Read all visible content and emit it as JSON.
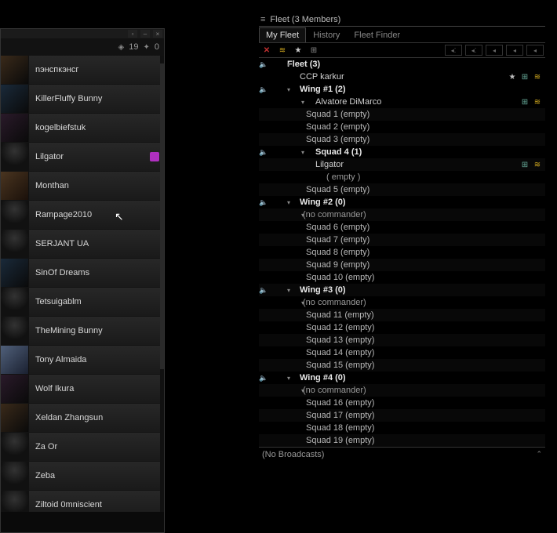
{
  "left_panel": {
    "stat1_icon": "◈",
    "stat1_val": "19",
    "stat2_icon": "✦",
    "stat2_val": "0",
    "members": [
      {
        "name": "nэнспкэнсг",
        "pclass": "p1"
      },
      {
        "name": "KillerFluffy Bunny",
        "pclass": "p2"
      },
      {
        "name": "kogelbiefstuk",
        "pclass": "p3"
      },
      {
        "name": "Lilgator",
        "pclass": "sil",
        "mic": true
      },
      {
        "name": "Monthan",
        "pclass": "p4"
      },
      {
        "name": "Rampage2010",
        "pclass": "sil"
      },
      {
        "name": "SERJANT UA",
        "pclass": "sil"
      },
      {
        "name": "SinOf Dreams",
        "pclass": "p2"
      },
      {
        "name": "Tetsuigablm",
        "pclass": "sil"
      },
      {
        "name": "TheMining Bunny",
        "pclass": "sil"
      },
      {
        "name": "Tony Almaida",
        "pclass": "p5"
      },
      {
        "name": "Wolf Ikura",
        "pclass": "p3"
      },
      {
        "name": "Xeldan Zhangsun",
        "pclass": "p1"
      },
      {
        "name": "Za Or",
        "pclass": "sil"
      },
      {
        "name": "Zeba",
        "pclass": "sil"
      },
      {
        "name": "Ziltoid 0mniscient",
        "pclass": "sil"
      }
    ]
  },
  "fleet": {
    "title": "Fleet (3 Members)",
    "tabs": [
      {
        "label": "My Fleet",
        "active": true
      },
      {
        "label": "History",
        "active": false
      },
      {
        "label": "Fleet Finder",
        "active": false
      }
    ],
    "hierarchy": [
      {
        "lvl": "lvl0",
        "label": "Fleet (3)",
        "speaker": true,
        "caret": 1,
        "icons": []
      },
      {
        "lvl": "lvl1",
        "label": "CCP karkur",
        "icons": [
          "star",
          "plus",
          "chev"
        ]
      },
      {
        "lvl": "lvl2",
        "label": "Wing  #1 (2)",
        "speaker": true,
        "caret": 1,
        "icons": []
      },
      {
        "lvl": "lvl3",
        "label": "Alvatore DiMarco",
        "caret": 2,
        "icons": [
          "plus",
          "chev"
        ]
      },
      {
        "lvl": "lvl4",
        "label": "Squad 1 (empty)",
        "stripe": true
      },
      {
        "lvl": "lvl4",
        "label": "Squad 2 (empty)"
      },
      {
        "lvl": "lvl4",
        "label": "Squad 3 (empty)",
        "stripe": true
      },
      {
        "lvl": "lvl4b",
        "label": "Squad 4 (1)",
        "speaker": true,
        "caret": 2
      },
      {
        "lvl": "lvl5",
        "label": "Lilgator",
        "stripe": true,
        "icons": [
          "plus",
          "chev"
        ]
      },
      {
        "lvl": "lvl5e",
        "label": "( empty )"
      },
      {
        "lvl": "lvl4",
        "label": "Squad 5 (empty)",
        "stripe": true
      },
      {
        "lvl": "lvl2",
        "label": "Wing  #2 (0)",
        "speaker": true,
        "caret": 1
      },
      {
        "lvl": "lvl3b",
        "label": "(no commander)",
        "stripe": true,
        "caret": 2
      },
      {
        "lvl": "lvl4",
        "label": "Squad 6 (empty)"
      },
      {
        "lvl": "lvl4",
        "label": "Squad 7 (empty)",
        "stripe": true
      },
      {
        "lvl": "lvl4",
        "label": "Squad 8 (empty)"
      },
      {
        "lvl": "lvl4",
        "label": "Squad 9 (empty)",
        "stripe": true
      },
      {
        "lvl": "lvl4",
        "label": "Squad 10 (empty)"
      },
      {
        "lvl": "lvl2",
        "label": "Wing  #3 (0)",
        "speaker": true,
        "stripe": true,
        "caret": 1
      },
      {
        "lvl": "lvl3b",
        "label": "(no commander)",
        "caret": 2
      },
      {
        "lvl": "lvl4",
        "label": "Squad 11 (empty)",
        "stripe": true
      },
      {
        "lvl": "lvl4",
        "label": "Squad 12 (empty)"
      },
      {
        "lvl": "lvl4",
        "label": "Squad 13 (empty)",
        "stripe": true
      },
      {
        "lvl": "lvl4",
        "label": "Squad 14 (empty)"
      },
      {
        "lvl": "lvl4",
        "label": "Squad 15 (empty)",
        "stripe": true
      },
      {
        "lvl": "lvl2",
        "label": "Wing  #4 (0)",
        "speaker": true,
        "caret": 1
      },
      {
        "lvl": "lvl3b",
        "label": "(no commander)",
        "stripe": true,
        "caret": 2
      },
      {
        "lvl": "lvl4",
        "label": "Squad 16 (empty)"
      },
      {
        "lvl": "lvl4",
        "label": "Squad 17 (empty)",
        "stripe": true
      },
      {
        "lvl": "lvl4",
        "label": "Squad 18 (empty)"
      },
      {
        "lvl": "lvl4",
        "label": "Squad 19 (empty)",
        "stripe": true
      }
    ],
    "broadcasts": "(No Broadcasts)"
  }
}
